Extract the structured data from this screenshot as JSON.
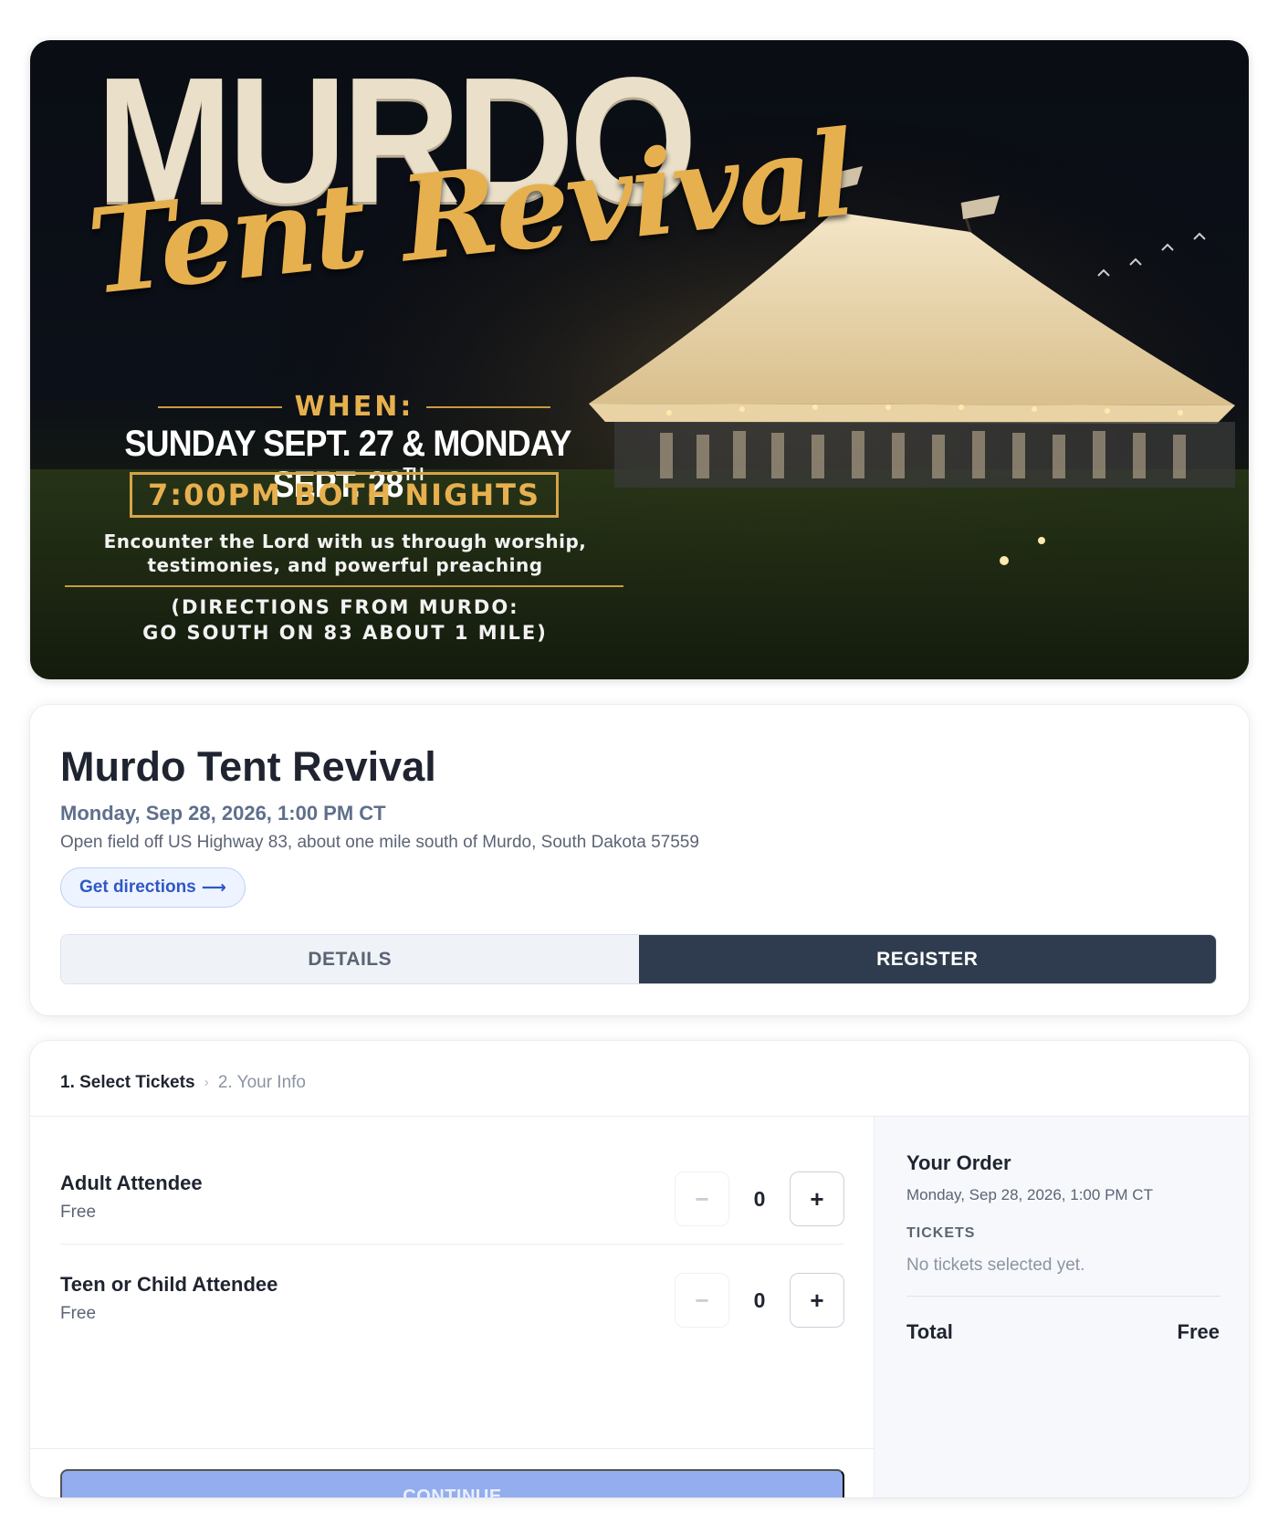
{
  "banner": {
    "title_main": "MURDO",
    "title_script": "Tent Revival",
    "when_label": "WHEN:",
    "dates": "SUNDAY SEPT. 27 & MONDAY SEPT. 28",
    "dates_suffix": "TH",
    "time": "7:00PM BOTH NIGHTS",
    "blurb_line1": "Encounter the Lord with us through worship,",
    "blurb_line2": "testimonies, and powerful preaching",
    "directions_line1": "(DIRECTIONS FROM MURDO:",
    "directions_line2": "GO SOUTH ON 83 ABOUT 1 MILE)"
  },
  "event": {
    "title": "Murdo Tent Revival",
    "datetime": "Monday, Sep 28, 2026, 1:00 PM CT",
    "address": "Open field off US Highway 83, about one mile south of Murdo, South Dakota 57559",
    "directions_label": "Get directions",
    "directions_arrow": "⟶"
  },
  "tabs": [
    {
      "label": "DETAILS",
      "active": false
    },
    {
      "label": "REGISTER",
      "active": true
    }
  ],
  "steps": {
    "current": "1. Select Tickets",
    "separator": "›",
    "next": "2. Your Info"
  },
  "tickets": [
    {
      "name": "Adult Attendee",
      "price": "Free",
      "quantity": "0",
      "minus": "−",
      "plus": "+"
    },
    {
      "name": "Teen or Child Attendee",
      "price": "Free",
      "quantity": "0",
      "minus": "−",
      "plus": "+"
    }
  ],
  "continue_label": "CONTINUE",
  "order": {
    "title": "Your Order",
    "datetime": "Monday, Sep 28, 2026, 1:00 PM CT",
    "tickets_label": "TICKETS",
    "empty_text": "No tickets selected yet.",
    "total_label": "Total",
    "total_value": "Free"
  },
  "colors": {
    "accent_gold": "#e7b04e",
    "tab_active_bg": "#2f3b4e",
    "link_blue": "#2f57c8",
    "continue_disabled_bg": "#93adef"
  }
}
